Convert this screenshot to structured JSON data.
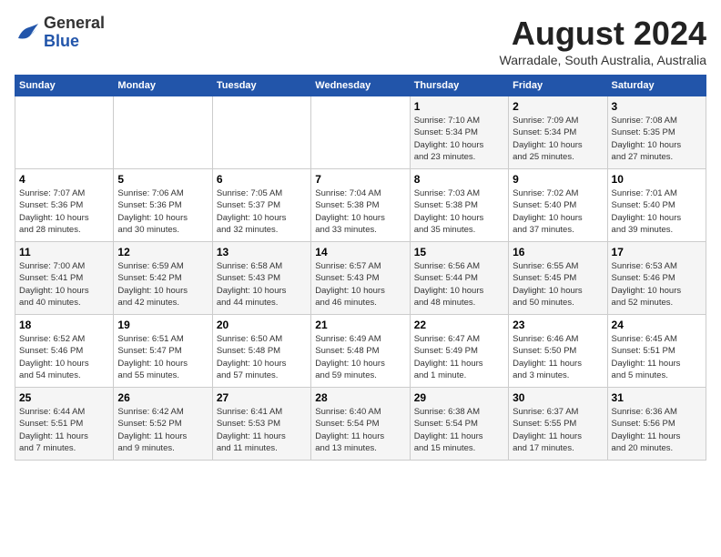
{
  "logo": {
    "general": "General",
    "blue": "Blue"
  },
  "title": "August 2024",
  "subtitle": "Warradale, South Australia, Australia",
  "days_of_week": [
    "Sunday",
    "Monday",
    "Tuesday",
    "Wednesday",
    "Thursday",
    "Friday",
    "Saturday"
  ],
  "weeks": [
    [
      {
        "num": "",
        "info": ""
      },
      {
        "num": "",
        "info": ""
      },
      {
        "num": "",
        "info": ""
      },
      {
        "num": "",
        "info": ""
      },
      {
        "num": "1",
        "info": "Sunrise: 7:10 AM\nSunset: 5:34 PM\nDaylight: 10 hours\nand 23 minutes."
      },
      {
        "num": "2",
        "info": "Sunrise: 7:09 AM\nSunset: 5:34 PM\nDaylight: 10 hours\nand 25 minutes."
      },
      {
        "num": "3",
        "info": "Sunrise: 7:08 AM\nSunset: 5:35 PM\nDaylight: 10 hours\nand 27 minutes."
      }
    ],
    [
      {
        "num": "4",
        "info": "Sunrise: 7:07 AM\nSunset: 5:36 PM\nDaylight: 10 hours\nand 28 minutes."
      },
      {
        "num": "5",
        "info": "Sunrise: 7:06 AM\nSunset: 5:36 PM\nDaylight: 10 hours\nand 30 minutes."
      },
      {
        "num": "6",
        "info": "Sunrise: 7:05 AM\nSunset: 5:37 PM\nDaylight: 10 hours\nand 32 minutes."
      },
      {
        "num": "7",
        "info": "Sunrise: 7:04 AM\nSunset: 5:38 PM\nDaylight: 10 hours\nand 33 minutes."
      },
      {
        "num": "8",
        "info": "Sunrise: 7:03 AM\nSunset: 5:38 PM\nDaylight: 10 hours\nand 35 minutes."
      },
      {
        "num": "9",
        "info": "Sunrise: 7:02 AM\nSunset: 5:40 PM\nDaylight: 10 hours\nand 37 minutes."
      },
      {
        "num": "10",
        "info": "Sunrise: 7:01 AM\nSunset: 5:40 PM\nDaylight: 10 hours\nand 39 minutes."
      }
    ],
    [
      {
        "num": "11",
        "info": "Sunrise: 7:00 AM\nSunset: 5:41 PM\nDaylight: 10 hours\nand 40 minutes."
      },
      {
        "num": "12",
        "info": "Sunrise: 6:59 AM\nSunset: 5:42 PM\nDaylight: 10 hours\nand 42 minutes."
      },
      {
        "num": "13",
        "info": "Sunrise: 6:58 AM\nSunset: 5:43 PM\nDaylight: 10 hours\nand 44 minutes."
      },
      {
        "num": "14",
        "info": "Sunrise: 6:57 AM\nSunset: 5:43 PM\nDaylight: 10 hours\nand 46 minutes."
      },
      {
        "num": "15",
        "info": "Sunrise: 6:56 AM\nSunset: 5:44 PM\nDaylight: 10 hours\nand 48 minutes."
      },
      {
        "num": "16",
        "info": "Sunrise: 6:55 AM\nSunset: 5:45 PM\nDaylight: 10 hours\nand 50 minutes."
      },
      {
        "num": "17",
        "info": "Sunrise: 6:53 AM\nSunset: 5:46 PM\nDaylight: 10 hours\nand 52 minutes."
      }
    ],
    [
      {
        "num": "18",
        "info": "Sunrise: 6:52 AM\nSunset: 5:46 PM\nDaylight: 10 hours\nand 54 minutes."
      },
      {
        "num": "19",
        "info": "Sunrise: 6:51 AM\nSunset: 5:47 PM\nDaylight: 10 hours\nand 55 minutes."
      },
      {
        "num": "20",
        "info": "Sunrise: 6:50 AM\nSunset: 5:48 PM\nDaylight: 10 hours\nand 57 minutes."
      },
      {
        "num": "21",
        "info": "Sunrise: 6:49 AM\nSunset: 5:48 PM\nDaylight: 10 hours\nand 59 minutes."
      },
      {
        "num": "22",
        "info": "Sunrise: 6:47 AM\nSunset: 5:49 PM\nDaylight: 11 hours\nand 1 minute."
      },
      {
        "num": "23",
        "info": "Sunrise: 6:46 AM\nSunset: 5:50 PM\nDaylight: 11 hours\nand 3 minutes."
      },
      {
        "num": "24",
        "info": "Sunrise: 6:45 AM\nSunset: 5:51 PM\nDaylight: 11 hours\nand 5 minutes."
      }
    ],
    [
      {
        "num": "25",
        "info": "Sunrise: 6:44 AM\nSunset: 5:51 PM\nDaylight: 11 hours\nand 7 minutes."
      },
      {
        "num": "26",
        "info": "Sunrise: 6:42 AM\nSunset: 5:52 PM\nDaylight: 11 hours\nand 9 minutes."
      },
      {
        "num": "27",
        "info": "Sunrise: 6:41 AM\nSunset: 5:53 PM\nDaylight: 11 hours\nand 11 minutes."
      },
      {
        "num": "28",
        "info": "Sunrise: 6:40 AM\nSunset: 5:54 PM\nDaylight: 11 hours\nand 13 minutes."
      },
      {
        "num": "29",
        "info": "Sunrise: 6:38 AM\nSunset: 5:54 PM\nDaylight: 11 hours\nand 15 minutes."
      },
      {
        "num": "30",
        "info": "Sunrise: 6:37 AM\nSunset: 5:55 PM\nDaylight: 11 hours\nand 17 minutes."
      },
      {
        "num": "31",
        "info": "Sunrise: 6:36 AM\nSunset: 5:56 PM\nDaylight: 11 hours\nand 20 minutes."
      }
    ]
  ]
}
